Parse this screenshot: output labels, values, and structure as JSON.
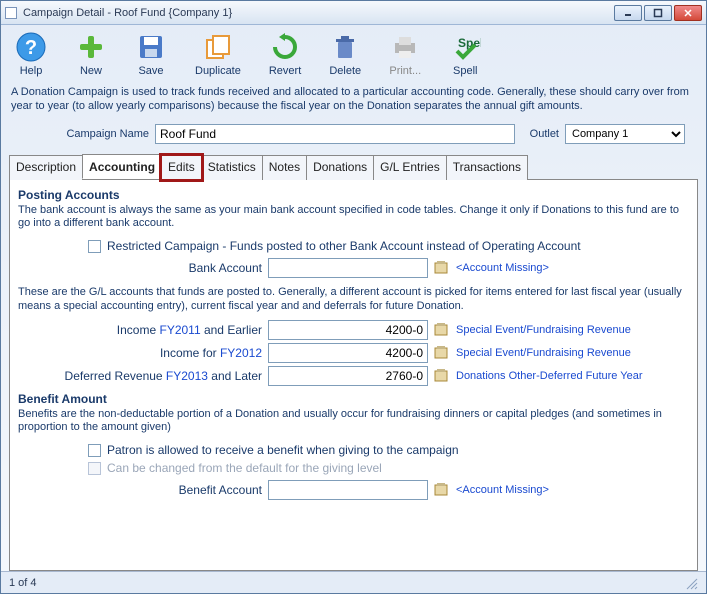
{
  "window": {
    "title": "Campaign Detail - Roof Fund {Company 1}"
  },
  "toolbar": {
    "help": "Help",
    "new": "New",
    "save": "Save",
    "duplicate": "Duplicate",
    "revert": "Revert",
    "delete": "Delete",
    "print": "Print...",
    "spell": "Spell",
    "spell2": "Spell"
  },
  "intro": "A Donation Campaign is used to track funds received and allocated to a particular accounting code.  Generally, these should carry over from year to year (to allow yearly comparisons) because the fiscal year on the Donation separates the annual gift amounts.",
  "campaign": {
    "name_label": "Campaign Name",
    "name_value": "Roof Fund",
    "outlet_label": "Outlet",
    "outlet_value": "Company 1"
  },
  "tabs": {
    "description": "Description",
    "accounting": "Accounting",
    "edits": "Edits",
    "statistics": "Statistics",
    "notes": "Notes",
    "donations": "Donations",
    "gl": "G/L Entries",
    "transactions": "Transactions"
  },
  "posting": {
    "title": "Posting Accounts",
    "desc": "The bank account is always the same as your main bank account specified in code tables.  Change it only if Donations to this fund are to go into a different bank account.",
    "restricted_label": "Restricted Campaign - Funds posted to other Bank Account instead of Operating Account",
    "bank_label": "Bank Account",
    "bank_value": "",
    "bank_missing": "<Account Missing>",
    "gl_desc": "These are the G/L accounts that funds are posted to.  Generally, a different account is picked for items entered for last fiscal year (usually means a special accounting entry), current fiscal year and and deferrals for future Donation.",
    "rows": [
      {
        "prefix": "Income ",
        "year": "FY2011",
        "suffix": " and Earlier",
        "value": "4200-0",
        "link": "Special Event/Fundraising Revenue"
      },
      {
        "prefix": "Income for ",
        "year": "FY2012",
        "suffix": "",
        "value": "4200-0",
        "link": "Special Event/Fundraising Revenue"
      },
      {
        "prefix": "Deferred Revenue ",
        "year": "FY2013",
        "suffix": " and Later",
        "value": "2760-0",
        "link": "Donations Other-Deferred Future Year"
      }
    ]
  },
  "benefit": {
    "title": "Benefit Amount",
    "desc": "Benefits are the non-deductable portion of a Donation and usually occur for fundraising dinners or capital pledges (and sometimes in proportion to the amount given)",
    "allow_label": "Patron is allowed to receive a benefit when giving to the campaign",
    "change_label": "Can be changed from the default for the giving level",
    "account_label": "Benefit Account",
    "account_value": "",
    "account_missing": "<Account Missing>"
  },
  "status": {
    "record": "1 of 4"
  }
}
